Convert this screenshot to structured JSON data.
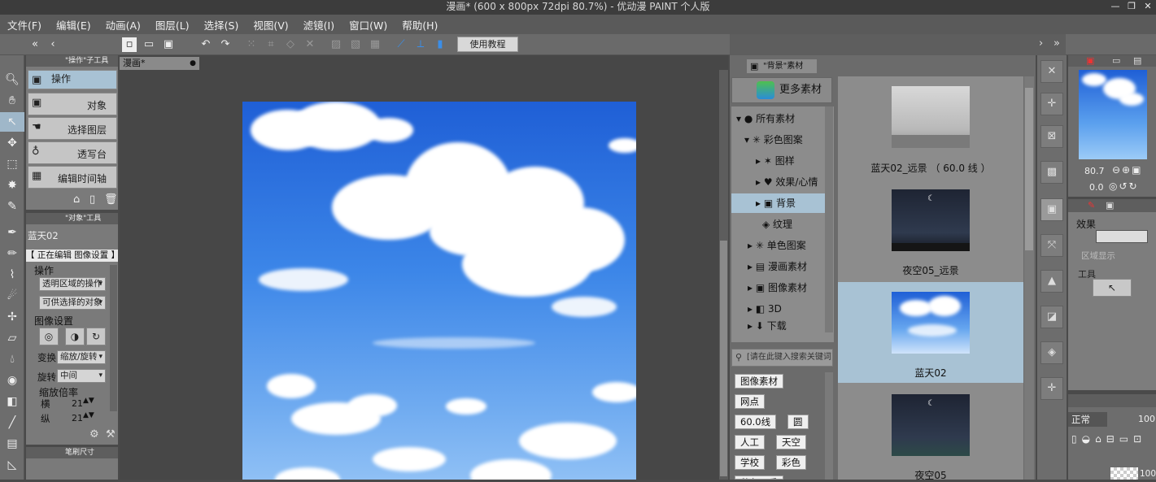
{
  "window": {
    "title": "漫画* (600 x 800px 72dpi 80.7%)  - 优动漫 PAINT 个人版",
    "controls": [
      "—",
      "❐",
      "✕"
    ]
  },
  "menu": [
    "文件(F)",
    "编辑(E)",
    "动画(A)",
    "图层(L)",
    "选择(S)",
    "视图(V)",
    "滤镜(I)",
    "窗口(W)",
    "帮助(H)"
  ],
  "toolbar": {
    "tutorial_label": "使用教程"
  },
  "subtool_panel": {
    "header": "\"操作\"子工具",
    "active_tab": "操作",
    "items": [
      "对象",
      "选择图层",
      "透写台",
      "编辑时间轴"
    ]
  },
  "tool_property": {
    "header": "\"对象\"工具",
    "layer_name": "蓝天02",
    "status": "【 正在编辑 图像设置 】",
    "section_operation": "操作",
    "transparent_op": "透明区域的操作",
    "selectable_obj": "可供选择的对象",
    "section_image": "图像设置",
    "transform_label": "变换",
    "transform_value": "缩放/旋转",
    "rotate_label": "旋转",
    "rotate_value": "中间",
    "scale_label": "缩放倍率",
    "horiz_label": "横",
    "horiz_value": "21",
    "vert_label": "纵",
    "vert_value": "21"
  },
  "brush_size": {
    "header": "笔刷尺寸"
  },
  "document": {
    "tab": "漫画*"
  },
  "materials": {
    "tab": "\"背景\"素材",
    "more_button": "更多素材",
    "tree": [
      {
        "label": "所有素材"
      },
      {
        "label": "彩色图案"
      },
      {
        "label": "图样"
      },
      {
        "label": "效果/心情"
      },
      {
        "label": "背景"
      },
      {
        "label": "纹理"
      },
      {
        "label": "单色图案"
      },
      {
        "label": "漫画素材"
      },
      {
        "label": "图像素材"
      },
      {
        "label": "3D"
      },
      {
        "label": "下载"
      }
    ],
    "search_placeholder": "[请在此键入搜索关键词]",
    "tags": [
      "图像素材",
      "网点",
      "60.0线",
      "圆",
      "人工",
      "天空",
      "学校",
      "彩色",
      "秋色四季"
    ],
    "thumbnails": [
      {
        "caption": "蓝天02_远景 （ 60.0 线 ）"
      },
      {
        "caption": "夜空05_远景"
      },
      {
        "caption": "蓝天02"
      },
      {
        "caption": "夜空05"
      }
    ]
  },
  "navigator": {
    "zoom": "80.7",
    "rotation": "0.0"
  },
  "effects": {
    "label": "效果",
    "area_display": "区域显示",
    "tool_label": "工具"
  },
  "layer": {
    "blend_mode": "正常",
    "opacity": "100",
    "layer_opacity": "100"
  }
}
